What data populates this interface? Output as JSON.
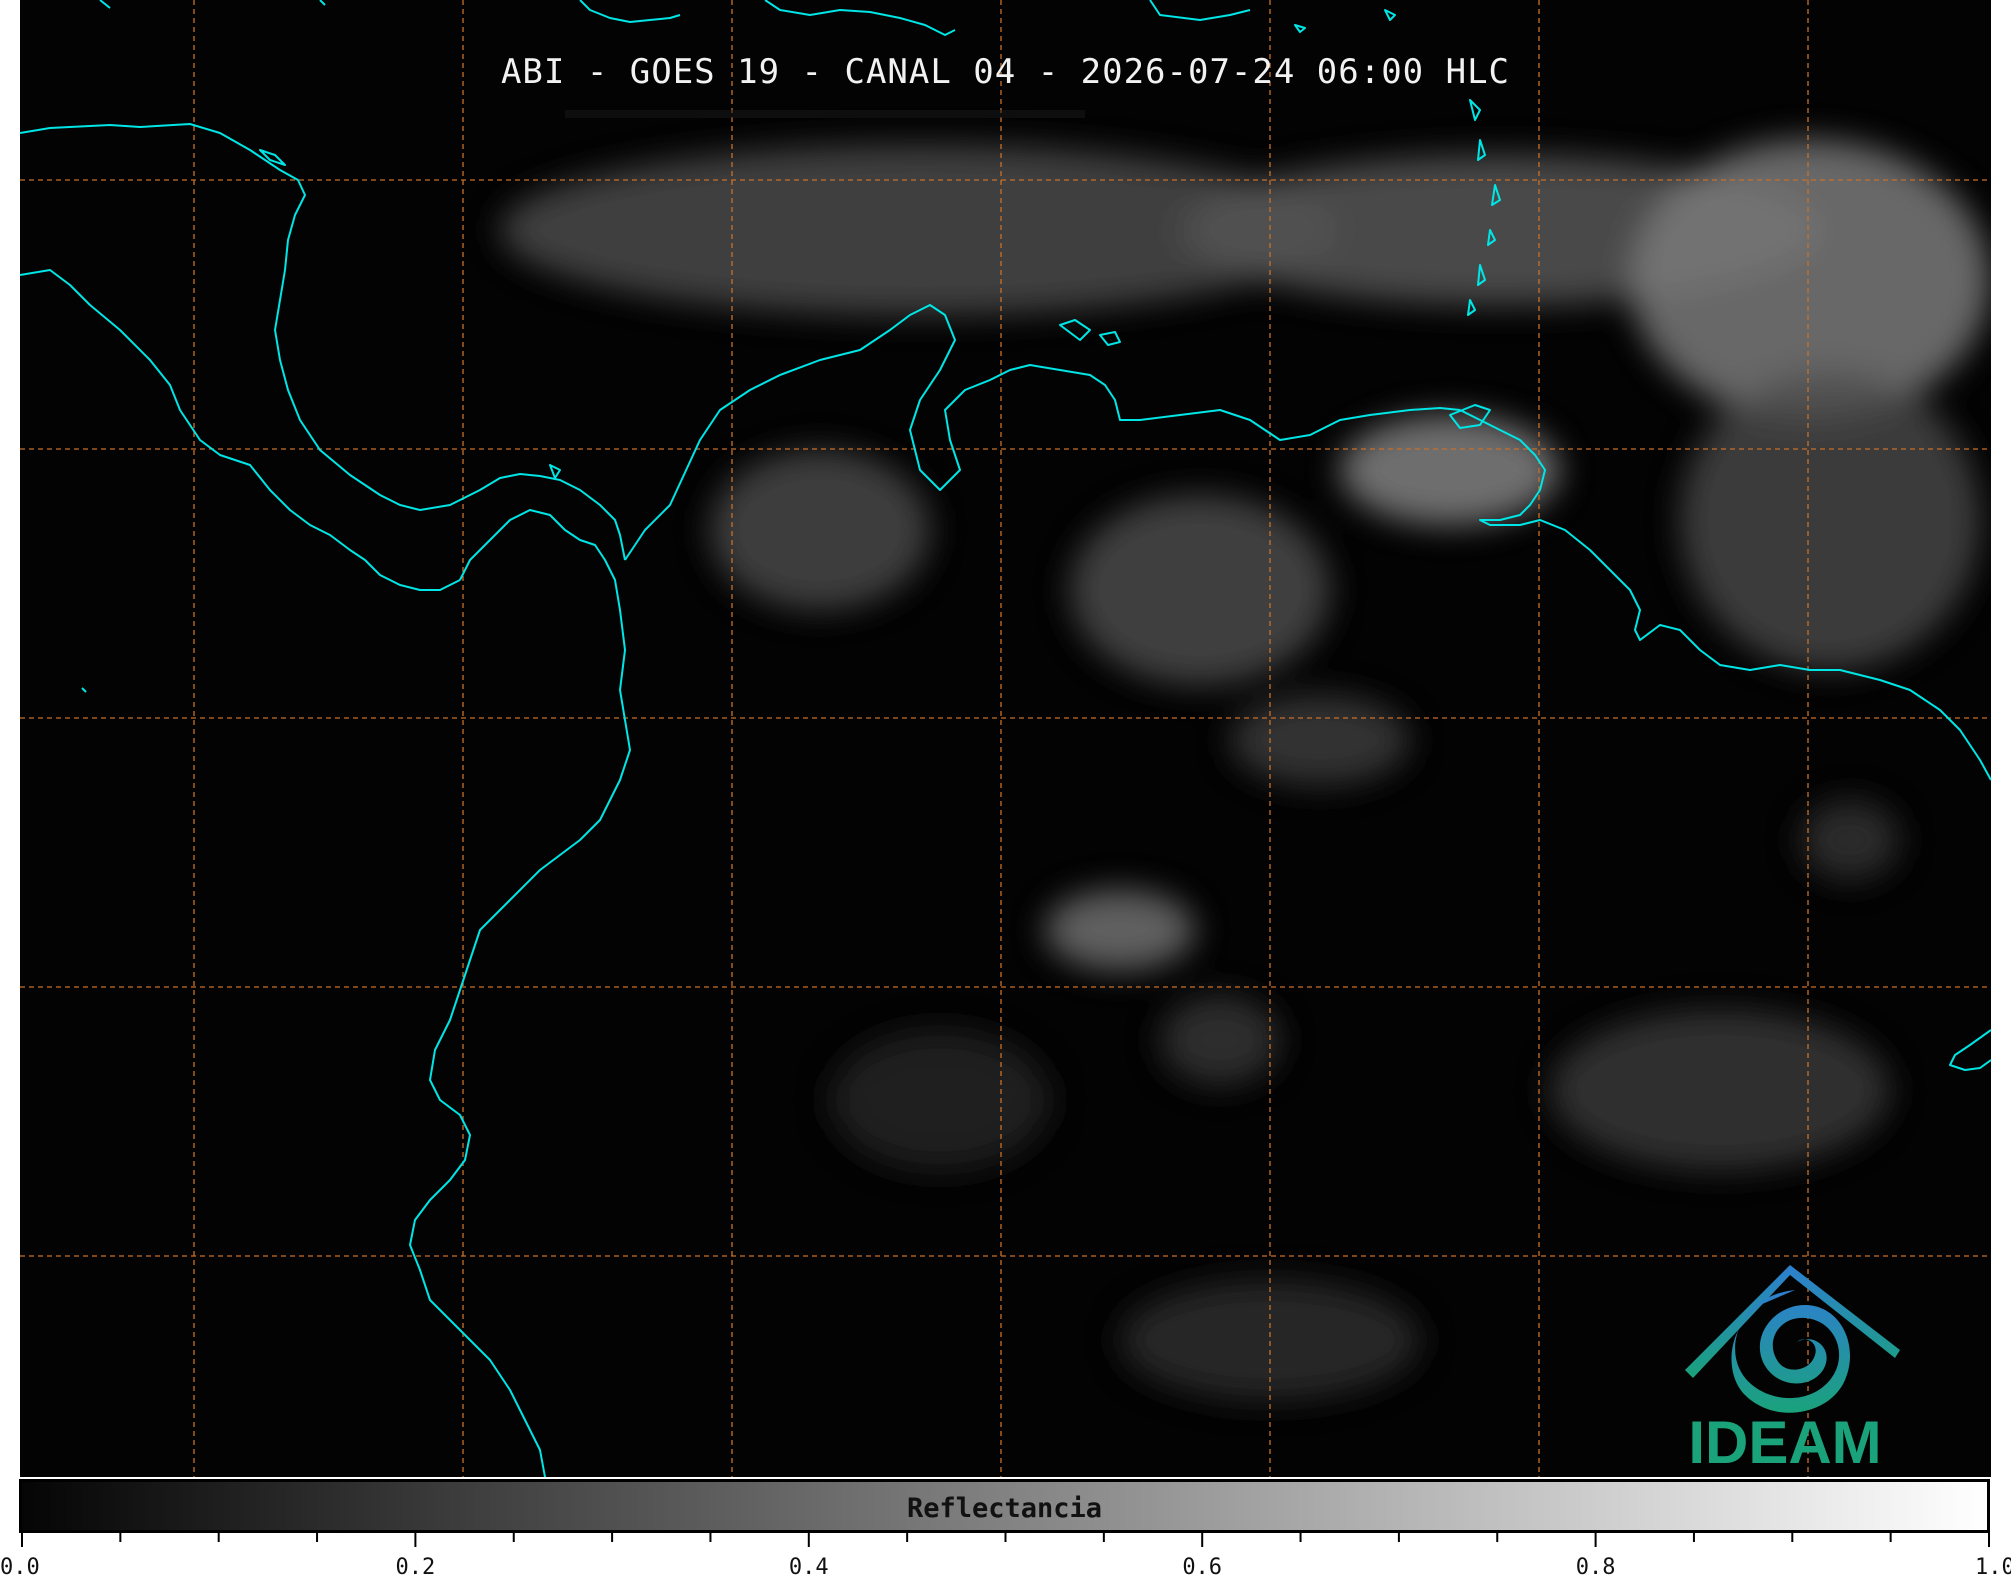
{
  "title": "ABI - GOES 19 - CANAL 04 - 2026-07-24 06:00 HLC",
  "colors": {
    "background": "#030303",
    "coastline": "#00e5e5",
    "gridline": "#c8702a",
    "cloud": "#9a9a9a",
    "logo_blue": "#2e7fd0",
    "logo_green": "#1aa27b"
  },
  "map": {
    "type": "satellite-image",
    "channel": "visible reflectance",
    "coastline_color_name": "cyan",
    "grid_style": "dashed"
  },
  "colorbar": {
    "label": "Reflectancia",
    "min": 0.0,
    "max": 1.0,
    "tick_labels": [
      "0.0",
      "0.2",
      "0.4",
      "0.6",
      "0.8",
      "1.0"
    ],
    "tick_values": [
      0.0,
      0.2,
      0.4,
      0.6,
      0.8,
      1.0
    ],
    "colormap": "black-to-white"
  },
  "logo": {
    "text": "IDEAM",
    "icon": "ideam-mountain-swirl-icon"
  }
}
